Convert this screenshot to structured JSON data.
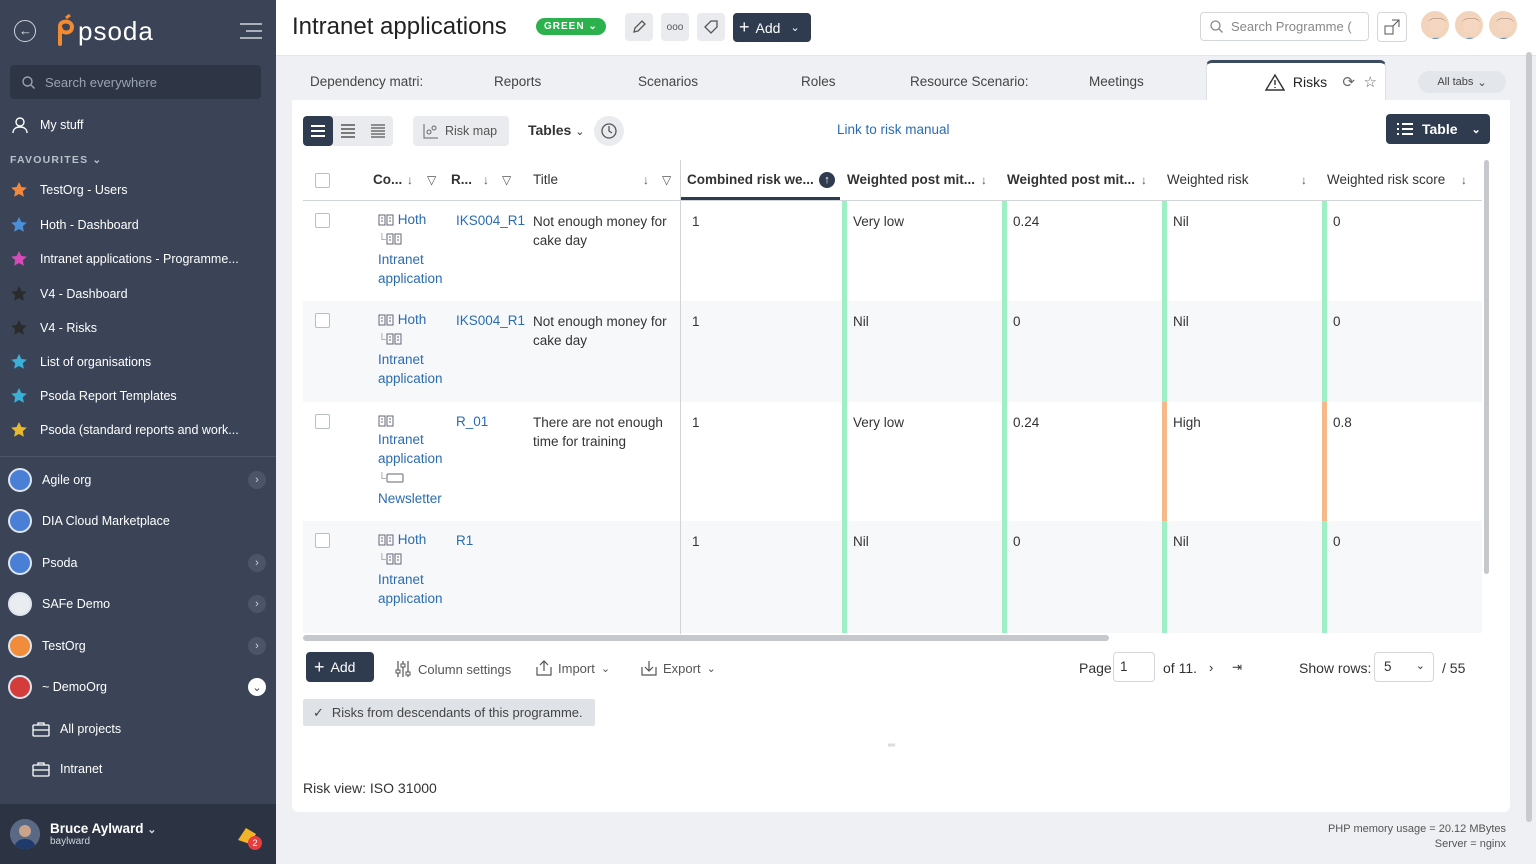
{
  "sidebar": {
    "brand": "psoda",
    "search_placeholder": "Search everywhere",
    "my_stuff": "My stuff",
    "favourites_heading": "FAVOURITES",
    "favourites": [
      {
        "label": "TestOrg - Users",
        "star_color": "#f0883e"
      },
      {
        "label": "Hoth - Dashboard",
        "star_color": "#4a90d9"
      },
      {
        "label": "Intranet applications - Programme...",
        "star_color": "#d64bb8"
      },
      {
        "label": "V4 - Dashboard",
        "star_color": "#2b2b2b"
      },
      {
        "label": "V4 - Risks",
        "star_color": "#2b2b2b"
      },
      {
        "label": "List of organisations",
        "star_color": "#3ab0d8"
      },
      {
        "label": "Psoda Report Templates",
        "star_color": "#3ab0d8"
      },
      {
        "label": "Psoda (standard reports and work...",
        "star_color": "#e8b830"
      }
    ],
    "orgs": [
      {
        "label": "Agile org",
        "has_chevron": true
      },
      {
        "label": "DIA Cloud Marketplace",
        "has_chevron": false
      },
      {
        "label": "Psoda",
        "has_chevron": true
      },
      {
        "label": "SAFe Demo",
        "has_chevron": true
      },
      {
        "label": "TestOrg",
        "has_chevron": true
      },
      {
        "label": "~ DemoOrg",
        "has_chevron": true
      }
    ],
    "sub_items": [
      "All projects",
      "Intranet"
    ],
    "user": {
      "name": "Bruce Aylward",
      "username": "baylward",
      "notification_count": "2"
    }
  },
  "header": {
    "title": "Intranet applications",
    "status_badge": "GREEN",
    "add_label": "Add",
    "search_placeholder": "Search Programme (",
    "dots_label": "ooo"
  },
  "tabs": {
    "items": [
      "Dependency matri:",
      "Reports",
      "Scenarios",
      "Roles",
      "Resource Scenario:",
      "Meetings"
    ],
    "active": "Risks",
    "all_tabs": "All tabs"
  },
  "toolbar": {
    "risk_map": "Risk map",
    "tables": "Tables",
    "link_risk_manual": "Link to risk manual",
    "view_mode": "Table"
  },
  "table": {
    "columns": [
      "Co...",
      "R...",
      "Title",
      "Combined risk we...",
      "Weighted post mit...",
      "Weighted post mit...",
      "Weighted risk",
      "Weighted risk score"
    ],
    "rows": [
      {
        "context": [
          "Hoth",
          "Intranet application"
        ],
        "ref": "IKS004_R1",
        "title": "Not enough money for cake day",
        "combined": "1",
        "wpm1": "Very low",
        "wpm2": "0.24",
        "wrisk": "Nil",
        "wscore": "0",
        "risk_color": "#9ef0c4"
      },
      {
        "context": [
          "Hoth",
          "Intranet application"
        ],
        "ref": "IKS004_R1",
        "title": "Not enough money for cake day",
        "combined": "1",
        "wpm1": "Nil",
        "wpm2": "0",
        "wrisk": "Nil",
        "wscore": "0",
        "risk_color": "#9ef0c4"
      },
      {
        "context": [
          "Intranet application",
          "Newsletter"
        ],
        "ref": "R_01",
        "title": "There are not enough time for training",
        "combined": "1",
        "wpm1": "Very low",
        "wpm2": "0.24",
        "wrisk": "High",
        "wscore": "0.8",
        "risk_color": "#f6b98a"
      },
      {
        "context": [
          "Hoth",
          "Intranet application"
        ],
        "ref": "R1",
        "title": "",
        "combined": "1",
        "wpm1": "Nil",
        "wpm2": "0",
        "wrisk": "Nil",
        "wscore": "0",
        "risk_color": "#9ef0c4"
      }
    ]
  },
  "footer": {
    "add": "Add",
    "column_settings": "Column settings",
    "import": "Import",
    "export": "Export",
    "page_label": "Page",
    "page_value": "1",
    "of_pages": "of 11.",
    "show_rows_label": "Show rows:",
    "show_rows_value": "5",
    "total": "/ 55",
    "descendants": "Risks from descendants of this programme.",
    "risk_view": "Risk view: ISO 31000"
  },
  "server": {
    "memory": "PHP memory usage = 20.12 MBytes",
    "server": "Server = nginx"
  }
}
